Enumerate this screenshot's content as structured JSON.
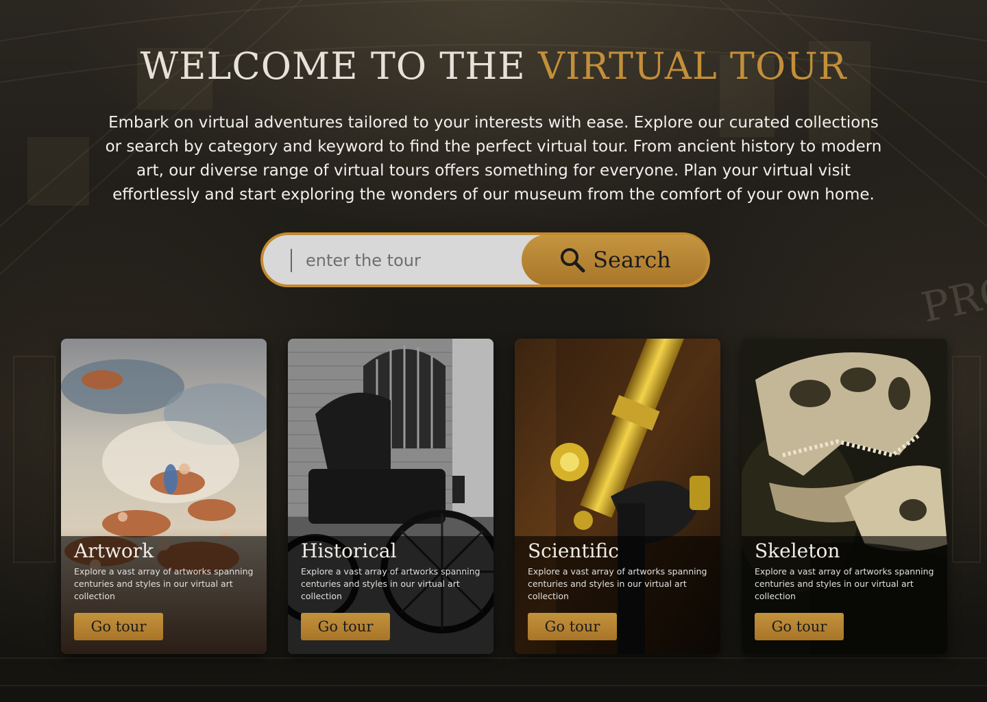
{
  "hero": {
    "title_part1": "WELCOME TO THE",
    "title_part2": "VIRTUAL TOUR",
    "description": "Embark on virtual adventures tailored to your interests with ease. Explore our curated collections or search by category and keyword to find the perfect virtual tour. From ancient history to modern art, our diverse range of virtual tours offers something for everyone. Plan your virtual visit effortlessly and start exploring the wonders of our museum from the comfort of your own home."
  },
  "search": {
    "placeholder": "enter the tour",
    "value": "",
    "button_label": "Search",
    "icon": "search-icon"
  },
  "cards": [
    {
      "title": "Artwork",
      "description": "Explore a vast array of artworks spanning centuries and styles in our virtual art collection",
      "button_label": "Go tour",
      "image": "baroque-ceiling-painting"
    },
    {
      "title": "Historical",
      "description": "Explore a vast array of artworks spanning centuries and styles in our virtual art collection",
      "button_label": "Go tour",
      "image": "vintage-carriage-photo"
    },
    {
      "title": "Scientific",
      "description": "Explore a vast array of artworks spanning centuries and styles in our virtual art collection",
      "button_label": "Go tour",
      "image": "brass-microscope"
    },
    {
      "title": "Skeleton",
      "description": "Explore a vast array of artworks spanning centuries and styles in our virtual art collection",
      "button_label": "Go tour",
      "image": "dinosaur-skull"
    }
  ],
  "colors": {
    "accent": "#c38f3a",
    "background": "#1c1a16",
    "title_light": "#e6e2da"
  }
}
